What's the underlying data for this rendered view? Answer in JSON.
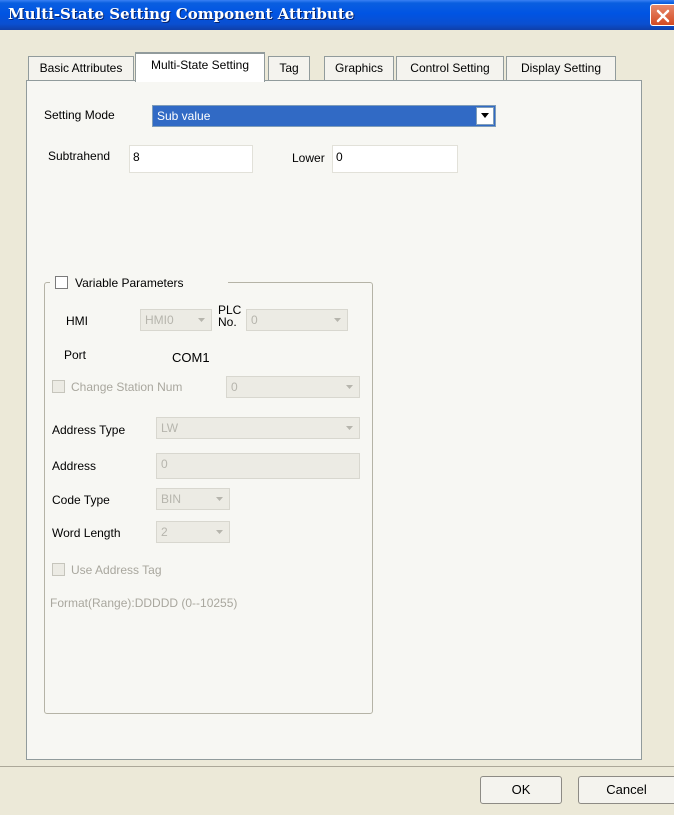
{
  "window": {
    "title": "Multi-State Setting Component Attribute"
  },
  "tabs": [
    {
      "label": "Basic Attributes",
      "active": false
    },
    {
      "label": "Multi-State Setting",
      "active": true
    },
    {
      "label": "Tag",
      "active": false
    },
    {
      "label": "Graphics",
      "active": false
    },
    {
      "label": "Control Setting",
      "active": false
    },
    {
      "label": "Display Setting",
      "active": false
    }
  ],
  "setting_mode": {
    "label": "Setting Mode",
    "value": "Sub value"
  },
  "subtrahend": {
    "label": "Subtrahend",
    "value": "8"
  },
  "lower": {
    "label": "Lower",
    "value": "0"
  },
  "variable_parameters": {
    "label": "Variable Parameters",
    "checked": false,
    "hmi_label": "HMI",
    "hmi_value": "HMI0",
    "plc_label_line1": "PLC",
    "plc_label_line2": "No.",
    "plc_value": "0",
    "port_label": "Port",
    "port_value": "COM1",
    "change_station_label": "Change Station Num",
    "change_station_value": "0",
    "address_type_label": "Address Type",
    "address_type_value": "LW",
    "address_label": "Address",
    "address_value": "0",
    "code_type_label": "Code Type",
    "code_type_value": "BIN",
    "word_length_label": "Word Length",
    "word_length_value": "2",
    "use_address_tag_label": "Use Address Tag",
    "format_text": "Format(Range):DDDDD (0--10255)"
  },
  "buttons": {
    "ok": "OK",
    "cancel": "Cancel"
  },
  "colors": {
    "titlebar": "#0054e3",
    "selection": "#316ac5",
    "dialog_bg": "#ece9d8"
  }
}
